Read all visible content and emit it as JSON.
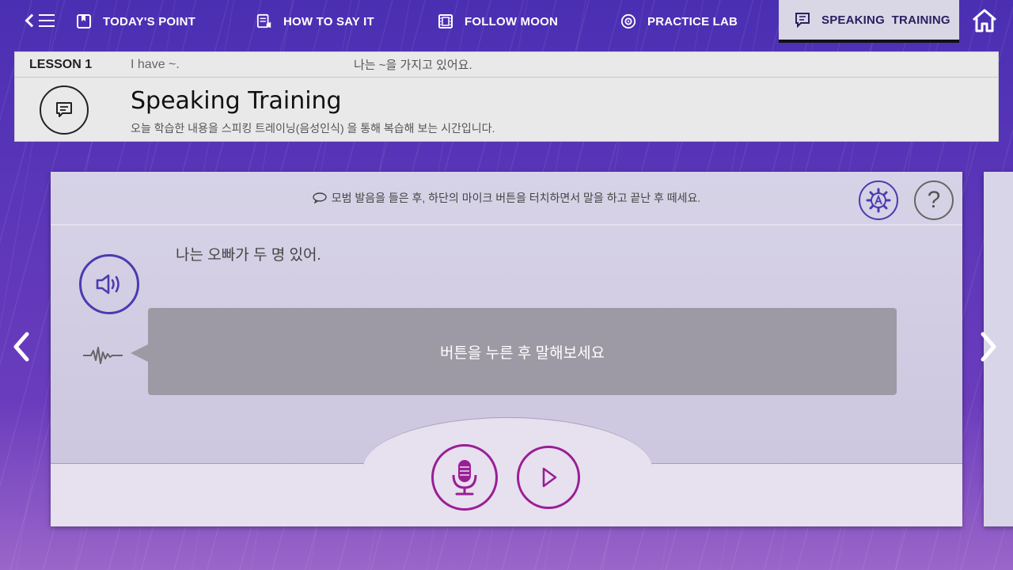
{
  "nav": {
    "items": [
      {
        "label": "TODAY'S POINT",
        "icon": "bookmark-icon"
      },
      {
        "label": "HOW TO SAY IT",
        "icon": "document-speak-icon"
      },
      {
        "label": "FOLLOW MOON",
        "icon": "film-icon"
      },
      {
        "label": "PRACTICE LAB",
        "icon": "disc-icon"
      },
      {
        "label": "SPEAKING  TRAINING",
        "icon": "chat-icon",
        "active": true
      }
    ]
  },
  "lesson": {
    "number": "LESSON 1",
    "english": "I have ~.",
    "korean": "나는 ~을 가지고 있어요.",
    "title": "Speaking Training",
    "description": "오늘 학습한 내용을 스피킹 트레이닝(음성인식) 을 통해 복습해 보는 시간입니다."
  },
  "card": {
    "instruction": "모범 발음을 들은 후, 하단의 마이크 버튼을 터치하면서 말을 하고 끝난 후 떼세요.",
    "sentence": "나는 오빠가 두 명 있어.",
    "result_prompt": "버튼을 누른 후 말해보세요",
    "help_glyph": "?"
  },
  "colors": {
    "accent": "#4a3bb0",
    "record": "#9a1f95"
  }
}
